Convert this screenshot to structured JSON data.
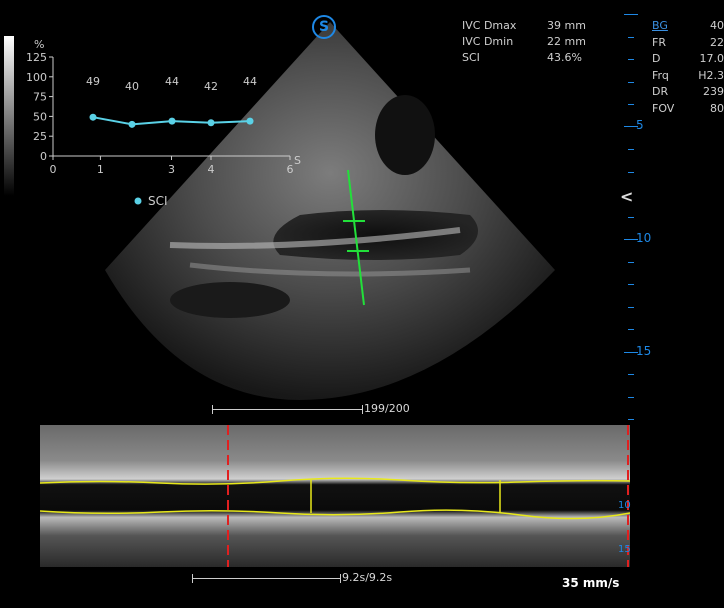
{
  "logo": "S",
  "measurements": [
    {
      "label": "IVC Dmax",
      "value": "39 mm"
    },
    {
      "label": "IVC Dmin",
      "value": "22 mm"
    },
    {
      "label": "SCI",
      "value": "43.6%"
    }
  ],
  "params": [
    {
      "label": "BG",
      "value": "40"
    },
    {
      "label": "FR",
      "value": "22"
    },
    {
      "label": "D",
      "value": "17.0"
    },
    {
      "label": "Frq",
      "value": "H2.3"
    },
    {
      "label": "DR",
      "value": "239"
    },
    {
      "label": "FOV",
      "value": "80"
    }
  ],
  "depth_labels": [
    "5",
    "10",
    "15"
  ],
  "frame_counter": "199/200",
  "time_counter": "9.2s/9.2s",
  "sweep_speed": "35 mm/s",
  "mmode_scale": [
    "10",
    "15"
  ],
  "chart_data": {
    "type": "line",
    "ylabel": "%",
    "xlabel": "S",
    "ylim": [
      0,
      125
    ],
    "xlim": [
      0,
      6
    ],
    "yticks": [
      "0",
      "25",
      "50",
      "75",
      "100",
      "125"
    ],
    "xticks": [
      "0",
      "1",
      "3",
      "4",
      "6"
    ],
    "x": [
      1,
      2,
      3,
      4,
      5
    ],
    "values": [
      49,
      40,
      44,
      42,
      44
    ],
    "series": [
      {
        "name": "SCI",
        "values": [
          49,
          40,
          44,
          42,
          44
        ],
        "color": "#5ad1e6"
      }
    ],
    "point_labels": [
      "49",
      "40",
      "44",
      "42",
      "44"
    ]
  }
}
